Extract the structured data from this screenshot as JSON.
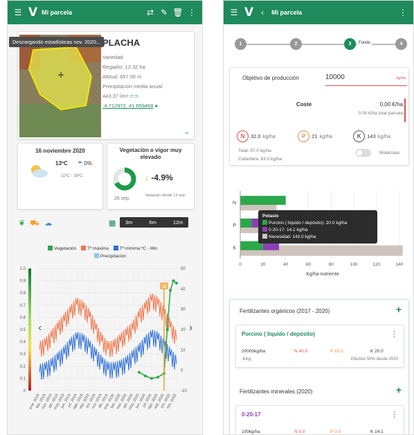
{
  "left": {
    "topbar": {
      "title": "Mi parcela",
      "logo": "V"
    },
    "toast": "Descargando estadísticas nov. 2020...",
    "parcel": {
      "name": "PLACHA",
      "crop": "Variedad",
      "regadio": "Regadío: 12.32 ha",
      "altitud": "Altitud: 697.00 m",
      "precip_label": "Precipitación media anual:",
      "precip_value": "443.37 l/m²",
      "coords": "-4.712972, 41.659468"
    },
    "weather": {
      "date": "16 noviembre 2020",
      "temp": "13ºC",
      "rain": "0%",
      "range": "11ºC - 16ºC"
    },
    "vigor": {
      "title": "Vegetación o vigor muy elevado",
      "gauge_value": "0.67",
      "change": "-4.9%",
      "date": "26 sep.",
      "note": "Variación desde 13 sep."
    },
    "chart_controls": {
      "ranges": [
        "3m",
        "6m",
        "12m"
      ]
    },
    "chart_legend": [
      "Vegetación",
      "Tª máxima",
      "Tª mínima ºC - Min",
      "Precipitación"
    ],
    "chart_badge": "16"
  },
  "right": {
    "topbar": {
      "title": "Mi parcela",
      "logo": "V"
    },
    "steps": [
      "1",
      "2",
      "3",
      "4"
    ],
    "step_active_label": "Fondo",
    "objetivo": {
      "label": "Objetivo de producción",
      "value": "10000",
      "unit": "kg/ha"
    },
    "coste": {
      "label": "Coste",
      "value": "0,00 €/ha",
      "total": "0.00 €/ha total parcela"
    },
    "nutrients": [
      {
        "letter": "N",
        "value": "32.0",
        "unit": "kg/ha",
        "color": "#d9534f"
      },
      {
        "letter": "P",
        "value": "21",
        "unit": "kg/ha",
        "color": "#e8884a"
      },
      {
        "letter": "K",
        "value": "143",
        "unit": "kg/ha",
        "color": "#555555"
      }
    ],
    "total_line": "Total: 97.0 kg/ha",
    "cobertura_line": "Cobertera: 63.0 kg/ha",
    "moleculas": "Moléculas",
    "tooltip": {
      "title": "Potasio",
      "rows": [
        "Porcino ( líquido / depósito): 20.0 kg/ha",
        "0-20-17: 14.1 kg/ha",
        "Necesidad: 143.0 kg/ha"
      ]
    },
    "fert_org": {
      "title": "Fertilizantes orgánicos (2017 - 2020)",
      "item": "Porcino ( líquido / depósito)",
      "dose": "20000kg/ha",
      "n": "N 40.0",
      "p": "P 10.0",
      "k": "K 20.0",
      "price": "-€/kg",
      "effect": "Efectivo 50% desde 2020"
    },
    "fert_min": {
      "title": "Fertilizantes minerales (2020)",
      "item": "0-20-17",
      "dose": "100kg/ha",
      "n": "N 0.0",
      "p": "P 0.0",
      "k": "K 14.1"
    }
  },
  "chart_data": [
    {
      "type": "line",
      "x": [
        "ene. 2019",
        "feb. 2019",
        "mar. 2019",
        "abr. 2019",
        "may. 2019",
        "jun. 2019",
        "jul. 2019",
        "ago. 2019",
        "sep. 2019",
        "oct. 2019",
        "nov. 2019",
        "dic. 2019",
        "ene. 2020",
        "feb. 2020",
        "mar. 2020",
        "abr. 2020",
        "may. 2020",
        "jun. 2020",
        "jul. 2020",
        "ago. 2020",
        "sep. 2020",
        "oct. 2020",
        "nov. 2020"
      ],
      "series": [
        {
          "name": "Tª máxima",
          "axis": "right",
          "values": [
            10,
            12,
            16,
            20,
            24,
            28,
            32,
            30,
            26,
            20,
            14,
            10,
            11,
            14,
            17,
            20,
            26,
            30,
            34,
            32,
            27,
            21,
            15
          ],
          "color": "#f0744a"
        },
        {
          "name": "Tª mínima ºC - Min",
          "axis": "right",
          "values": [
            -1,
            0,
            2,
            5,
            8,
            12,
            15,
            14,
            11,
            7,
            3,
            0,
            0,
            1,
            3,
            6,
            9,
            13,
            16,
            15,
            11,
            7,
            3
          ],
          "color": "#2f6fd6"
        },
        {
          "name": "Vegetación",
          "axis": "left",
          "x_index": [
            16,
            17,
            18,
            19,
            20,
            20.5,
            21,
            21.5,
            22
          ],
          "values": [
            0.15,
            0.12,
            0.1,
            0.11,
            0.14,
            0.5,
            0.82,
            0.9,
            0.88
          ],
          "color": "#2aa84a"
        }
      ],
      "ylim_left": [
        0,
        1
      ],
      "ylim_right": [
        -10,
        50
      ],
      "yticks_left": [
        "0",
        "0.1",
        "0.2",
        "0.3",
        "0.4",
        "0.5",
        "0.6",
        "0.7",
        "0.8",
        "0.9",
        "1.0"
      ],
      "yticks_right": [
        "-10",
        "0",
        "10",
        "20",
        "30",
        "40",
        "50"
      ]
    },
    {
      "type": "bar",
      "orientation": "horizontal",
      "categories": [
        "N",
        "P",
        "K"
      ],
      "series": [
        {
          "name": "Porcino ( líquido / depósito)",
          "values": [
            40,
            10,
            20
          ],
          "color": "#2aa84a"
        },
        {
          "name": "0-20-17",
          "values": [
            0,
            11,
            14.1
          ],
          "color": "#8e3fb5"
        },
        {
          "name": "Necesidad",
          "values": [
            32,
            21,
            143
          ],
          "color": "#cfc3bd"
        }
      ],
      "xlabel": "Kg/ha nutriente",
      "xticks": [
        "0",
        "20",
        "40",
        "60",
        "80",
        "100",
        "120",
        "140"
      ],
      "xlim": [
        0,
        145
      ]
    }
  ]
}
